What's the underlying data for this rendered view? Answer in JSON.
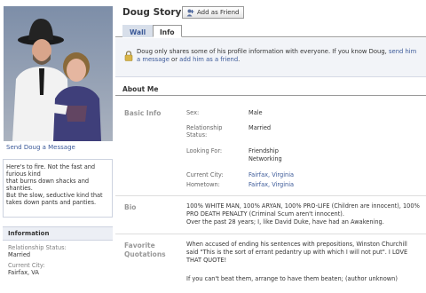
{
  "profile": {
    "name": "Doug Story",
    "add_friend_label": "Add as Friend",
    "send_message": "Send Doug a Message"
  },
  "tabs": [
    {
      "label": "Wall"
    },
    {
      "label": "Info"
    }
  ],
  "bio_box": {
    "lines": [
      "Here's to fire. Not the fast and",
      "furious kind",
      "that burns down shacks and",
      "shanties.",
      "But the slow, seductive kind that",
      "takes down pants and panties."
    ]
  },
  "info_box": {
    "title": "Information",
    "relationship_label": "Relationship Status:",
    "relationship_value": "Married",
    "city_label": "Current City:",
    "city_value": "Fairfax, VA"
  },
  "notice": {
    "text_before": "Doug only shares some of his profile information with everyone. If you know Doug, ",
    "link1": "send him a message",
    "text_mid": " or ",
    "link2": "add him as a friend",
    "text_after": "."
  },
  "about": {
    "heading": "About Me",
    "basic_info_label": "Basic Info",
    "fields": {
      "sex_key": "Sex:",
      "sex_val": "Male",
      "rel_key_1": "Relationship",
      "rel_key_2": "Status:",
      "rel_val": "Married",
      "looking_key": "Looking For:",
      "looking_val_1": "Friendship",
      "looking_val_2": "Networking",
      "city_key": "Current City:",
      "city_val": "Fairfax, Virginia",
      "hometown_key": "Hometown:",
      "hometown_val": "Fairfax, Virginia"
    },
    "bio_label": "Bio",
    "bio_text_1": "100% WHITE MAN, 100% ARYAN, 100% PRO-LIFE (Children are innocent), 100%",
    "bio_text_2": "PRO DEATH PENALTY (Criminal Scum aren't innocent).",
    "bio_text_3": "Over the past 28 years; I, like David Duke, have had an Awakening.",
    "quotes_label_1": "Favorite",
    "quotes_label_2": "Quotations",
    "quote_1_a": "When accused of ending his sentences with prepositions, Winston Churchill",
    "quote_1_b": "said \"This is the sort of errant pedantry up with which I will not put\". I LOVE",
    "quote_1_c": "THAT QUOTE!",
    "quote_2": "If you can't beat them, arrange to have them beaten; (author unknown)"
  },
  "colors": {
    "link": "#3b5998",
    "label_gray": "#999999",
    "tab_bg": "#d8dfea"
  }
}
